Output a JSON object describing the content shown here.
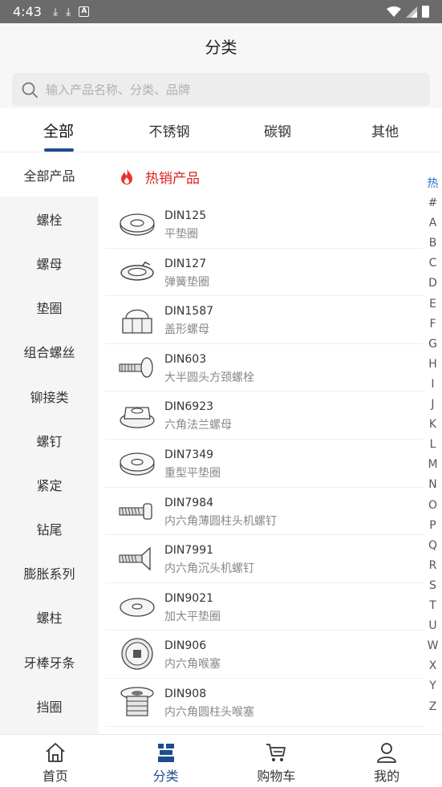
{
  "status_bar": {
    "time": "4:43",
    "icons": [
      "download-icon",
      "download-icon",
      "a-icon"
    ],
    "right_icons": [
      "wifi-icon",
      "signal-icon",
      "battery-icon"
    ]
  },
  "header": {
    "title": "分类"
  },
  "search": {
    "placeholder": "输入产品名称、分类、品牌"
  },
  "tabs": [
    {
      "label": "全部"
    },
    {
      "label": "不锈钢"
    },
    {
      "label": "碳钢"
    },
    {
      "label": "其他"
    }
  ],
  "active_tab": 0,
  "sidebar": {
    "items": [
      {
        "label": "全部产品"
      },
      {
        "label": "螺栓"
      },
      {
        "label": "螺母"
      },
      {
        "label": "垫圈"
      },
      {
        "label": "组合螺丝"
      },
      {
        "label": "铆接类"
      },
      {
        "label": "螺钉"
      },
      {
        "label": "紧定"
      },
      {
        "label": "钻尾"
      },
      {
        "label": "膨胀系列"
      },
      {
        "label": "螺柱"
      },
      {
        "label": "牙棒牙条"
      },
      {
        "label": "挡圈"
      }
    ]
  },
  "hot": {
    "title": "热销产品",
    "icon": "fire-icon"
  },
  "products": [
    {
      "code": "DIN125",
      "name": "平垫圈",
      "icon": "flat-washer-icon"
    },
    {
      "code": "DIN127",
      "name": "弹簧垫圈",
      "icon": "spring-washer-icon"
    },
    {
      "code": "DIN1587",
      "name": "盖形螺母",
      "icon": "cap-nut-icon"
    },
    {
      "code": "DIN603",
      "name": "大半圆头方颈螺栓",
      "icon": "carriage-bolt-icon"
    },
    {
      "code": "DIN6923",
      "name": "六角法兰螺母",
      "icon": "flange-nut-icon"
    },
    {
      "code": "DIN7349",
      "name": "重型平垫圈",
      "icon": "heavy-washer-icon"
    },
    {
      "code": "DIN7984",
      "name": "内六角薄圆柱头机螺钉",
      "icon": "socket-screw-icon"
    },
    {
      "code": "DIN7991",
      "name": "内六角沉头机螺钉",
      "icon": "countersunk-screw-icon"
    },
    {
      "code": "DIN9021",
      "name": "加大平垫圈",
      "icon": "large-washer-icon"
    },
    {
      "code": "DIN906",
      "name": "内六角喉塞",
      "icon": "socket-plug-icon"
    },
    {
      "code": "DIN908",
      "name": "内六角圆柱头喉塞",
      "icon": "collar-plug-icon"
    }
  ],
  "index_bar": {
    "hot": "热",
    "letters": [
      "#",
      "A",
      "B",
      "C",
      "D",
      "E",
      "F",
      "G",
      "H",
      "I",
      "J",
      "K",
      "L",
      "M",
      "N",
      "O",
      "P",
      "Q",
      "R",
      "S",
      "T",
      "U",
      "W",
      "X",
      "Y",
      "Z"
    ]
  },
  "bottom_nav": {
    "items": [
      {
        "label": "首页",
        "icon": "home-icon"
      },
      {
        "label": "分类",
        "icon": "category-icon"
      },
      {
        "label": "购物车",
        "icon": "cart-icon"
      },
      {
        "label": "我的",
        "icon": "user-icon"
      }
    ],
    "active": 1
  },
  "colors": {
    "accent": "#1d4d8c",
    "hot": "#e02020",
    "index_hot": "#2a6cc4"
  }
}
